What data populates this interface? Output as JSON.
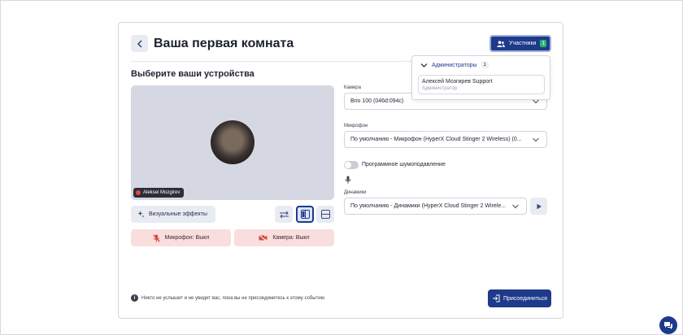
{
  "room": {
    "title": "Ваша первая комната",
    "participants_label": "Участники",
    "participants_count": "1"
  },
  "devices": {
    "heading": "Выберите ваши устройства",
    "camera": {
      "label": "Камера",
      "value": "Brio 100 (046d:094c)"
    },
    "microphone": {
      "label": "Микрофон",
      "value": "По умолчанию - Микрофон (HyperX Cloud Stinger 2 Wireless) (0..."
    },
    "noise_suppression_label": "Программное шумоподавление",
    "speakers": {
      "label": "Динамики",
      "value": "По умолчанию - Динамики (HyperX Cloud Stinger 2 Wirele..."
    }
  },
  "preview": {
    "user_name": "Aleksei Mozgirev"
  },
  "controls": {
    "effects_label": "Визуальные эффекты",
    "mic_label": "Микрофон: Выкл",
    "camera_label": "Камера: Выкл"
  },
  "footer": {
    "info_text": "Никто не услышит и не увидит вас, пока вы не присоединитесь к этому событию",
    "join_label": "Присоединиться"
  },
  "dropdown": {
    "group_label": "Администраторы",
    "group_count": "1",
    "member_name": "Алексей Мозгирев Support",
    "member_role": "Администратор"
  },
  "colors": {
    "accent": "#1e3a8a",
    "danger_bg": "#f9dede",
    "success": "#2bb673"
  },
  "icons": {
    "back": "chevron-left-icon",
    "participants": "users-icon",
    "effects": "sparkle-icon",
    "mic_off": "mic-off-icon",
    "camera_off": "camera-off-icon",
    "play": "play-icon",
    "info": "info-icon",
    "join": "login-icon",
    "chat": "chat-icon"
  }
}
